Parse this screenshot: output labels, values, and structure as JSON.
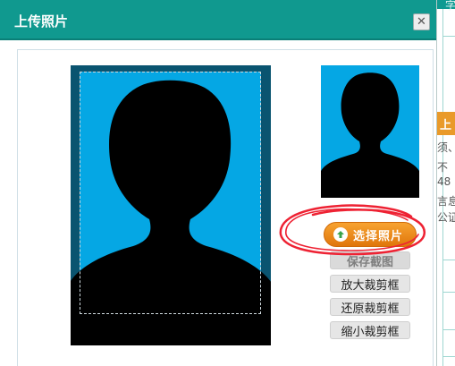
{
  "dialog": {
    "title": "上传照片",
    "close_symbol": "✕"
  },
  "buttons": {
    "choose_photo": "选择照片",
    "save_crop": "保存截图",
    "enlarge_crop": "放大裁剪框",
    "restore_crop": "还原裁剪框",
    "shrink_crop": "缩小裁剪框"
  },
  "background_page": {
    "top_char": "字",
    "orange_tab": "上",
    "fragments": [
      "须、",
      "不",
      "48",
      "言息",
      "公证"
    ]
  },
  "icons": {
    "close": "close-icon",
    "upload": "upload-arrow-icon"
  },
  "colors": {
    "titlebar": "#10998f",
    "photo_background": "#05a7e4",
    "choose_button": "#f08a1d",
    "annotation_circle": "#ee2233"
  }
}
